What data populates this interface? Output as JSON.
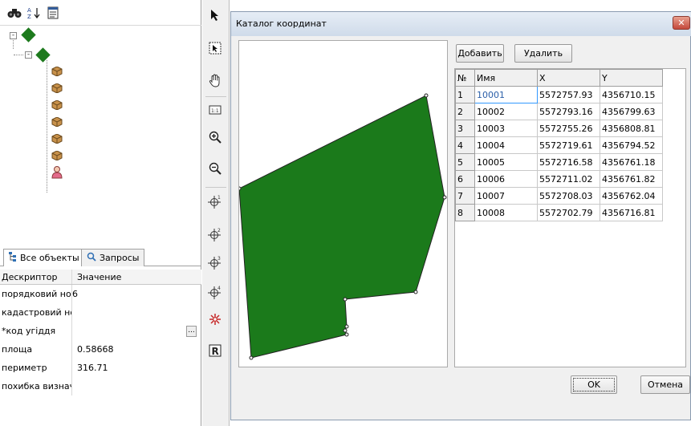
{
  "left_panel": {
    "toolbar": [
      {
        "icon": "binoculars-icon",
        "glyph": "🔍"
      },
      {
        "icon": "sort-az-icon",
        "glyph": "A↓"
      },
      {
        "icon": "properties-icon",
        "glyph": "▤"
      }
    ],
    "tabs": [
      {
        "label": "Все объекты",
        "icon": "all-objects-icon"
      },
      {
        "label": "Запросы",
        "icon": "query-icon"
      }
    ],
    "properties": {
      "headers": {
        "descriptor": "Дескриптор",
        "value": "Значение"
      },
      "rows": [
        {
          "descriptor": "порядковий ном",
          "value": "6"
        },
        {
          "descriptor": "кадастровий но",
          "value": ""
        },
        {
          "descriptor": "*код угіддя",
          "value": ""
        },
        {
          "descriptor": "площа",
          "value": "0.58668"
        },
        {
          "descriptor": "периметр",
          "value": "316.71"
        },
        {
          "descriptor": "похибка визнач",
          "value": ""
        }
      ],
      "ellipsis_label": "..."
    }
  },
  "vertical_toolbar": [
    {
      "icon": "pointer-arrow-icon",
      "glyph": "➤"
    },
    {
      "icon": "select-point-icon",
      "glyph": "⬚"
    },
    {
      "icon": "pan-hand-icon",
      "glyph": "✋"
    },
    {
      "icon": "ruler-icon",
      "glyph": "▭"
    },
    {
      "icon": "zoom-in-icon",
      "glyph": "⊕"
    },
    {
      "icon": "zoom-out-icon",
      "glyph": "⊖"
    },
    {
      "icon": "crosshair-add-icon",
      "glyph": "⌖"
    },
    {
      "icon": "crosshair-move-icon",
      "glyph": "⌖"
    },
    {
      "icon": "crosshair-insert-icon",
      "glyph": "⌖"
    },
    {
      "icon": "crosshair-edit-icon",
      "glyph": "⌖"
    },
    {
      "icon": "delete-point-icon",
      "glyph": "✳"
    },
    {
      "icon": "r-mode-icon",
      "glyph": "R"
    }
  ],
  "dialog": {
    "title": "Каталог координат",
    "close_label": "✕",
    "buttons": {
      "add": "Добавить",
      "remove": "Удалить",
      "ok": "OK",
      "cancel": "Отмена"
    },
    "table": {
      "headers": [
        "№",
        "Имя",
        "X",
        "Y"
      ],
      "rows": [
        [
          "1",
          "10001",
          "5572757.93",
          "4356710.15"
        ],
        [
          "2",
          "10002",
          "5572793.16",
          "4356799.63"
        ],
        [
          "3",
          "10003",
          "5572755.26",
          "4356808.81"
        ],
        [
          "4",
          "10004",
          "5572719.61",
          "4356794.52"
        ],
        [
          "5",
          "10005",
          "5572716.58",
          "4356761.18"
        ],
        [
          "6",
          "10006",
          "5572711.02",
          "4356761.82"
        ],
        [
          "7",
          "10007",
          "5572708.03",
          "4356762.04"
        ],
        [
          "8",
          "10008",
          "5572702.79",
          "4356716.81"
        ]
      ]
    },
    "polygon_fill": "#1b7a1b"
  }
}
